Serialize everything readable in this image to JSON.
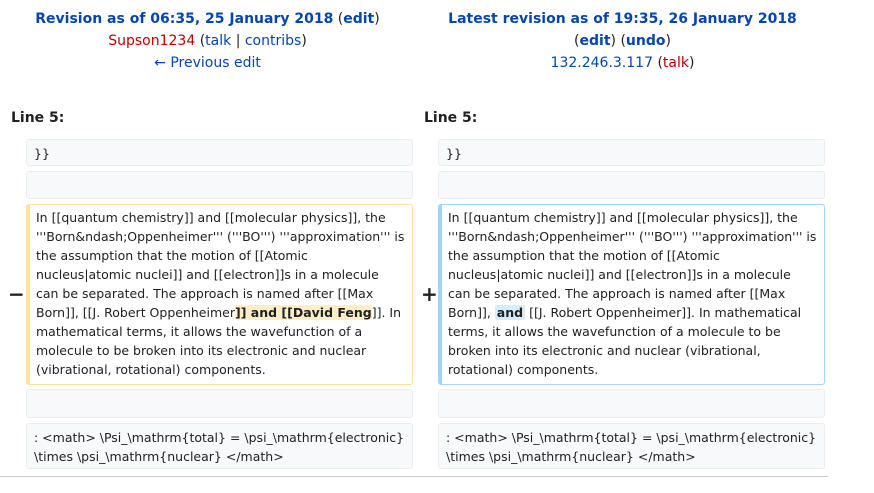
{
  "left": {
    "title": "Revision as of 06:35, 25 January 2018",
    "edit": "edit",
    "user": "Supson1234",
    "talk": "talk",
    "contribs": "contribs",
    "prev": "← Previous edit"
  },
  "right": {
    "title": "Latest revision as of 19:35, 26 January 2018",
    "edit": "edit",
    "undo": "undo",
    "ip": "132.246.3.117",
    "talk": "talk"
  },
  "line_label": "Line 5:",
  "context1": "}}",
  "context_math": ": <math> \\Psi_\\mathrm{total} = \\psi_\\mathrm{electronic} \\times \\psi_\\mathrm{nuclear} </math>",
  "del": {
    "marker": "−",
    "pre": "In [[quantum chemistry]] and [[molecular physics]], the '''Born&ndash;Oppenheimer''' ('''BO''') '''approximation''' is the assumption that the motion of [[Atomic nucleus|atomic nuclei]] and [[electron]]s in a molecule can be separated. The approach is named after [[Max Born]], [[J. Robert Oppenheimer",
    "changed": "]] and [[David Feng",
    "post": "]]. In mathematical terms, it allows the wavefunction of a molecule to be broken into its electronic and nuclear (vibrational, rotational) components."
  },
  "add": {
    "marker": "+",
    "pre": "In [[quantum chemistry]] and [[molecular physics]], the '''Born&ndash;Oppenheimer''' ('''BO''') '''approximation''' is the assumption that the motion of [[Atomic nucleus|atomic nuclei]] and [[electron]]s in a molecule can be separated. The approach is named after [[Max Born]],",
    "changed": "and",
    "post": "[[J. Robert Oppenheimer]]. In mathematical terms, it allows the wavefunction of a molecule to be broken into its electronic and nuclear (vibrational, rotational) components."
  }
}
